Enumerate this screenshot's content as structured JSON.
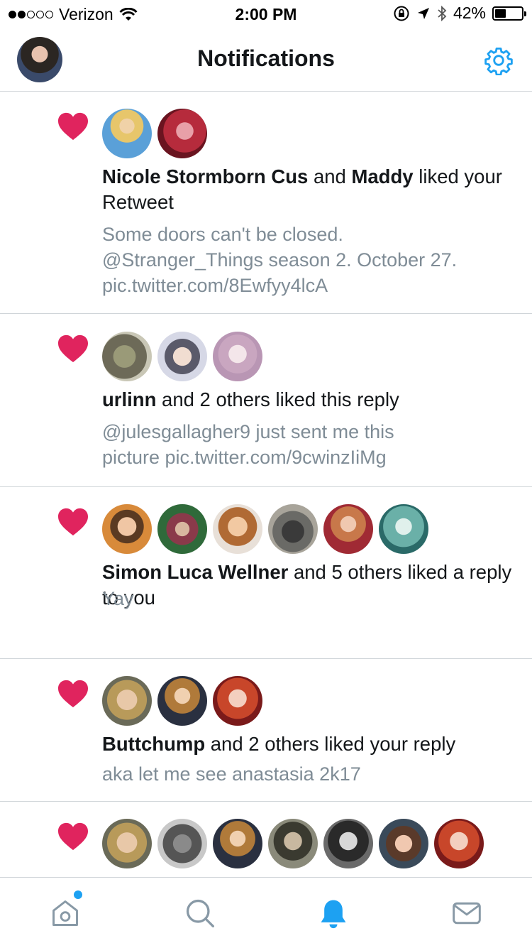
{
  "status_bar": {
    "carrier": "Verizon",
    "time": "2:00 PM",
    "battery": "42%",
    "battery_level": 0.42
  },
  "header": {
    "title": "Notifications"
  },
  "notifications": [
    {
      "actor1": "Nicole Stormborn Cus",
      "connector1": " and ",
      "actor2": "Maddy",
      "action": " liked your Retweet",
      "line1": "Some doors can't be closed.",
      "line2": "@Stranger_Things season 2. October 27.",
      "line3": "pic.twitter.com/8Ewfyy4lcA"
    },
    {
      "actor1": "urlinn",
      "action": " and 2 others liked this reply",
      "line1": "@julesgallagher9 just sent me this",
      "line2": "picture pic.twitter.com/9cwinzIiMg"
    },
    {
      "actor1": "Simon Luca Wellner",
      "action": " and 5 others liked a reply to you",
      "line1": "Yay"
    },
    {
      "actor1": "Buttchump",
      "action": " and 2 others liked your reply",
      "line1": "aka let me see anastasia 2k17"
    }
  ],
  "colors": {
    "accent": "#1da1f2",
    "heart": "#e0245e",
    "secondary_text": "#7f8c96"
  },
  "icons": {
    "settings": "gear-icon",
    "like": "heart-icon",
    "tab_home": "home-icon",
    "tab_search": "search-icon",
    "tab_notifications": "bell-icon",
    "tab_messages": "mail-icon"
  }
}
